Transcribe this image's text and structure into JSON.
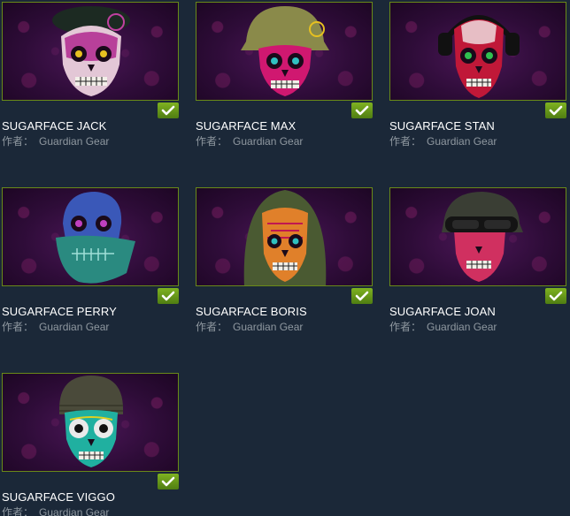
{
  "items": [
    {
      "title": "SUGARFACE JACK",
      "by_label": "作者：",
      "author": "Guardian Gear",
      "headwear": "beret",
      "icon": "skull-beret-icon"
    },
    {
      "title": "SUGARFACE MAX",
      "by_label": "作者：",
      "author": "Guardian Gear",
      "headwear": "helmet",
      "icon": "skull-helmet-icon"
    },
    {
      "title": "SUGARFACE STAN",
      "by_label": "作者：",
      "author": "Guardian Gear",
      "headwear": "headset",
      "icon": "skull-headset-icon"
    },
    {
      "title": "SUGARFACE PERRY",
      "by_label": "作者：",
      "author": "Guardian Gear",
      "headwear": "bandana",
      "icon": "skull-bandana-icon"
    },
    {
      "title": "SUGARFACE BORIS",
      "by_label": "作者：",
      "author": "Guardian Gear",
      "headwear": "hood",
      "icon": "skull-hood-icon"
    },
    {
      "title": "SUGARFACE JOAN",
      "by_label": "作者：",
      "author": "Guardian Gear",
      "headwear": "goggles",
      "icon": "skull-goggles-icon"
    },
    {
      "title": "SUGARFACE VIGGO",
      "by_label": "作者：",
      "author": "Guardian Gear",
      "headwear": "beanie",
      "icon": "skull-beanie-icon"
    }
  ],
  "colors": {
    "background": "#1b2838",
    "title": "#ffffff",
    "byline": "#8f98a0",
    "check": "#5c8a14",
    "thumb_border": "#6a8a18",
    "thumb_bg": "#3a0f45"
  }
}
